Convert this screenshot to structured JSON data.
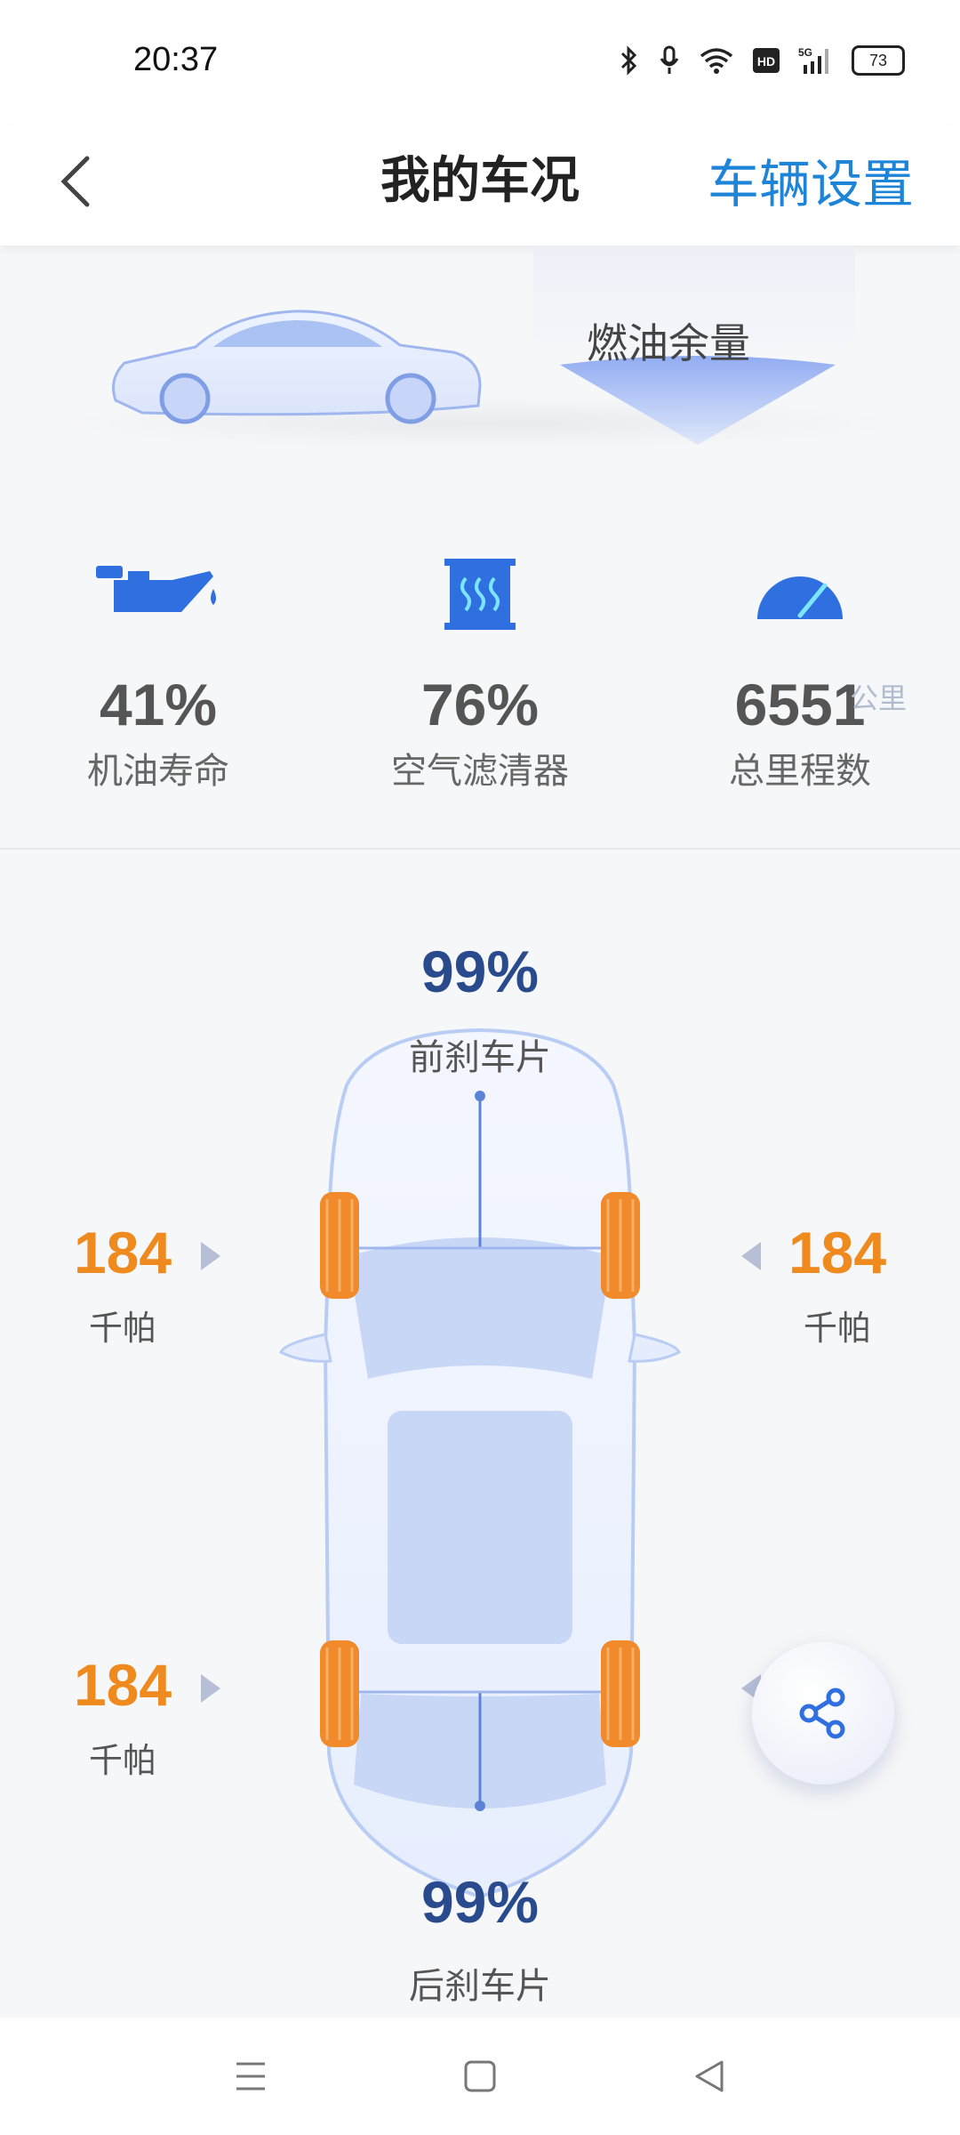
{
  "status_bar": {
    "time": "20:37",
    "battery": "73",
    "icons": [
      "bluetooth-icon",
      "microphone-icon",
      "wifi-icon",
      "hd-icon",
      "5g-signal-icon",
      "battery-icon"
    ]
  },
  "header": {
    "title": "我的车况",
    "settings_label": "车辆设置",
    "back_icon": "chevron-left-icon"
  },
  "fuel": {
    "label": "燃油余量"
  },
  "stats": [
    {
      "value": "41%",
      "label": "机油寿命",
      "icon": "oil-can-icon"
    },
    {
      "value": "76%",
      "label": "空气滤清器",
      "icon": "air-filter-icon"
    },
    {
      "value": "6551",
      "unit": "公里",
      "label": "总里程数",
      "icon": "speedometer-icon"
    }
  ],
  "brakes": {
    "front": {
      "value": "99%",
      "label": "前刹车片"
    },
    "rear": {
      "value": "99%",
      "label": "后刹车片"
    }
  },
  "tyres": {
    "front_left": {
      "value": "184",
      "unit": "千帕"
    },
    "front_right": {
      "value": "184",
      "unit": "千帕"
    },
    "rear_left": {
      "value": "184",
      "unit": "千帕"
    }
  },
  "colors": {
    "accent": "#1e84d8",
    "pressure": "#ef8a1f",
    "brake": "#2a4a8e",
    "car_body": "#c9d7f7",
    "tyre": "#f08a2a"
  },
  "share_icon": "share-icon",
  "nav": [
    "menu-icon",
    "home-square-icon",
    "back-triangle-icon"
  ]
}
